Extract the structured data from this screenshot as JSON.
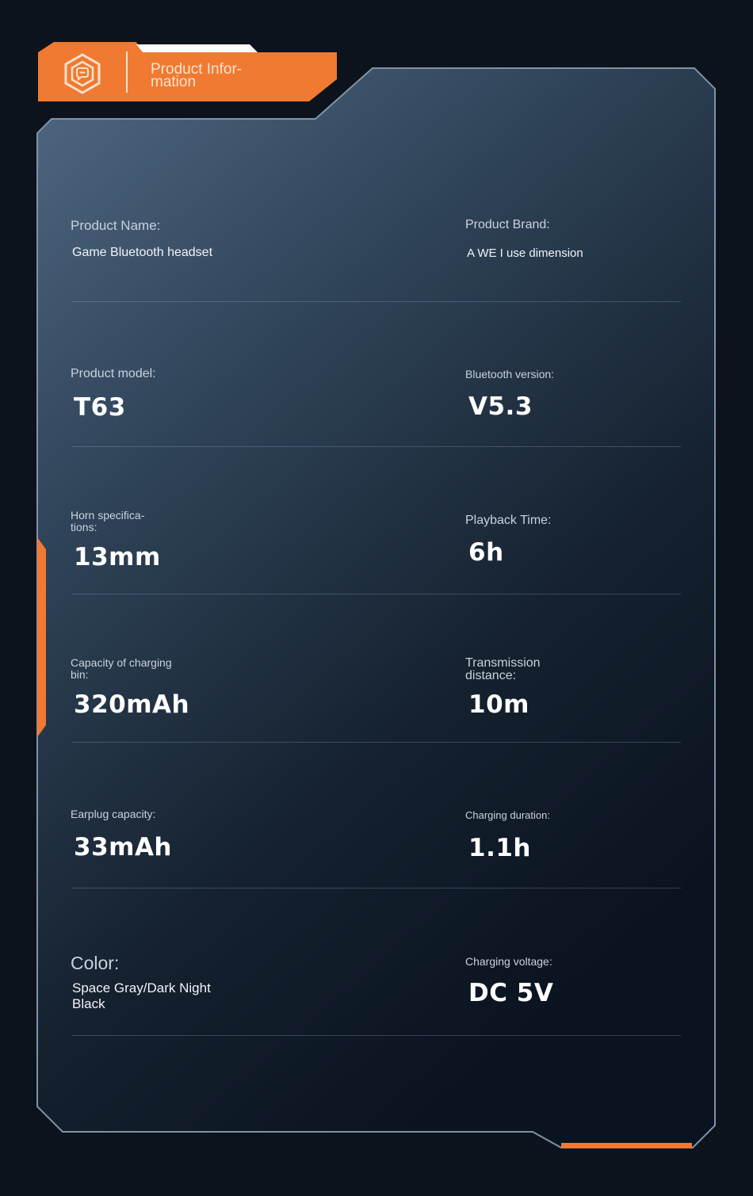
{
  "header": {
    "tab_title": "Product Infor-\nmation",
    "icon": "hexagon-chat-icon"
  },
  "colors": {
    "accent": "#f07a31",
    "panel_top": "#4b637d",
    "panel_bottom": "#0c1522",
    "background": "#0d131c"
  },
  "specs": {
    "product_name": {
      "label": "Product Name:",
      "value": "Game Bluetooth headset"
    },
    "product_brand": {
      "label": "Product Brand:",
      "value": "A WE I use dimension"
    },
    "product_model": {
      "label": "Product model:",
      "value": "T63"
    },
    "bluetooth_version": {
      "label": "Bluetooth version:",
      "value": "V5.3"
    },
    "horn_spec": {
      "label": "Horn specifica-\ntions:",
      "value": "13mm"
    },
    "playback_time": {
      "label": "Playback Time:",
      "value": "6h"
    },
    "charging_bin_capacity": {
      "label": "Capacity of charging\nbin:",
      "value": "320mAh"
    },
    "transmission_distance": {
      "label": "Transmission\ndistance:",
      "value": "10m"
    },
    "earplug_capacity": {
      "label": "Earplug capacity:",
      "value": "33mAh"
    },
    "charging_duration": {
      "label": "Charging duration:",
      "value": "1.1h"
    },
    "color": {
      "label": "Color:",
      "value": "Space Gray/Dark Night\nBlack"
    },
    "charging_voltage": {
      "label": "Charging voltage:",
      "value": "DC 5V"
    }
  }
}
